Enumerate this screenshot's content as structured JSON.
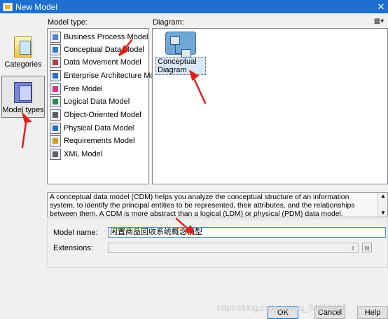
{
  "window": {
    "title": "New Model",
    "close_glyph": "✕"
  },
  "categories": {
    "items": [
      {
        "label": "Categories",
        "icon": "categories-icon",
        "selected": false
      },
      {
        "label": "Model types",
        "icon": "model-types-icon",
        "selected": true
      }
    ]
  },
  "model_type": {
    "heading": "Model type:",
    "items": [
      {
        "label": "Business Process Model",
        "icon": "business-process-model-icon",
        "color": "#5a7fd0"
      },
      {
        "label": "Conceptual Data Model",
        "icon": "conceptual-data-model-icon",
        "color": "#3a78c0",
        "selected": true
      },
      {
        "label": "Data Movement Model",
        "icon": "data-movement-model-icon",
        "color": "#b04040"
      },
      {
        "label": "Enterprise Architecture Model",
        "icon": "enterprise-architecture-model-icon",
        "color": "#3a6ac0"
      },
      {
        "label": "Free Model",
        "icon": "free-model-icon",
        "color": "#e03080"
      },
      {
        "label": "Logical Data Model",
        "icon": "logical-data-model-icon",
        "color": "#2a8a50"
      },
      {
        "label": "Object-Oriented Model",
        "icon": "object-oriented-model-icon",
        "color": "#5a5a5a"
      },
      {
        "label": "Physical Data Model",
        "icon": "physical-data-model-icon",
        "color": "#2a70c0"
      },
      {
        "label": "Requirements Model",
        "icon": "requirements-model-icon",
        "color": "#d0a020"
      },
      {
        "label": "XML Model",
        "icon": "xml-model-icon",
        "color": "#606060"
      }
    ]
  },
  "diagram": {
    "heading": "Diagram:",
    "view_button_icon": "view-mode-icon",
    "items": [
      {
        "label": "Conceptual Diagram",
        "icon": "conceptual-diagram-icon",
        "selected": true
      }
    ]
  },
  "description": {
    "text": "A conceptual data model (CDM) helps you analyze the conceptual structure of an information system, to identify the principal entities to be represented, their attributes, and the relationships between them. A CDM is more abstract than a logical (LDM) or physical (PDM) data model."
  },
  "fields": {
    "model_name_label": "Model name:",
    "model_name_value": "闲置商品回收系统概念模型",
    "extensions_label": "Extensions:",
    "extensions_value": ""
  },
  "buttons": {
    "ok": "OK",
    "cancel": "Cancel",
    "help": "Help"
  },
  "watermark": "https://blog.csdn.net/qq_34651407",
  "colors": {
    "titlebar": "#1e6fcf",
    "annotation_arrow": "#e0201c"
  }
}
